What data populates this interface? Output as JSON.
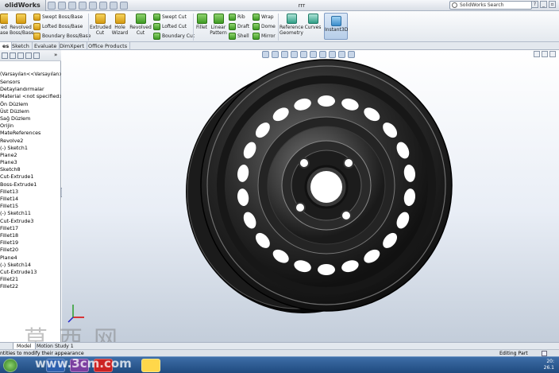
{
  "app": {
    "brand": "olidWorks",
    "doc_title": "rrr",
    "search_placeholder": "SolidWorks Search"
  },
  "ribbon": {
    "features": [
      {
        "label": "ed\nase",
        "icon": "extruded-boss-icon"
      },
      {
        "label": "Revolved\nBoss/Base",
        "icon": "revolved-boss-icon"
      }
    ],
    "small_col1": [
      "Swept Boss/Base",
      "Lofted Boss/Base",
      "Boundary Boss/Base"
    ],
    "cut_big": [
      {
        "label": "Extruded\nCut",
        "icon": "extruded-cut-icon"
      },
      {
        "label": "Hole\nWizard",
        "icon": "hole-wizard-icon"
      },
      {
        "label": "Revolved\nCut",
        "icon": "revolved-cut-icon"
      }
    ],
    "small_col2": [
      "Swept Cut",
      "Lofted Cut",
      "Boundary Cut"
    ],
    "fillet": "Fillet",
    "linear_pattern": "Linear\nPattern",
    "small_col3": [
      "Rib",
      "Draft",
      "Shell"
    ],
    "small_col4": [
      "Wrap",
      "Dome",
      "Mirror"
    ],
    "reference_geometry": "Reference\nGeometry",
    "curves": "Curves",
    "instant3d": "Instant3D"
  },
  "command_tabs": [
    "es",
    "Sketch",
    "Evaluate",
    "DimXpert",
    "Office Products"
  ],
  "tree": {
    "root": "(Varsayılan<<Varsayılan>_G",
    "items": [
      "Sensors",
      "Detaylandırmalar",
      "Material <not specified>",
      "Ön Düzlem",
      "Üst Düzlem",
      "Sağ Düzlem",
      "Orijin",
      "MateReferences",
      "Revolve2",
      "(-) Sketch1",
      "Plane2",
      "Plane3",
      "Sketch8",
      "Cut-Extrude1",
      "Boss-Extrude1",
      "Fillet13",
      "Fillet14",
      "Fillet15",
      "(-) Sketch11",
      "Cut-Extrude3",
      "Fillet17",
      "Fillet18",
      "Fillet19",
      "Fillet20",
      "Plane4",
      "(-) Sketch14",
      "Cut-Extrude13",
      "Fillet21",
      "Fillet22"
    ]
  },
  "bottom_tabs": [
    "Model",
    "Motion Study 1"
  ],
  "status": {
    "left": "ntities to modify their appearance",
    "right": "Editing Part"
  },
  "taskbar": {
    "clock_time": "20:",
    "clock_date": "26.1"
  },
  "watermark": {
    "chars": "草西网",
    "site": "www.3cm.com"
  }
}
